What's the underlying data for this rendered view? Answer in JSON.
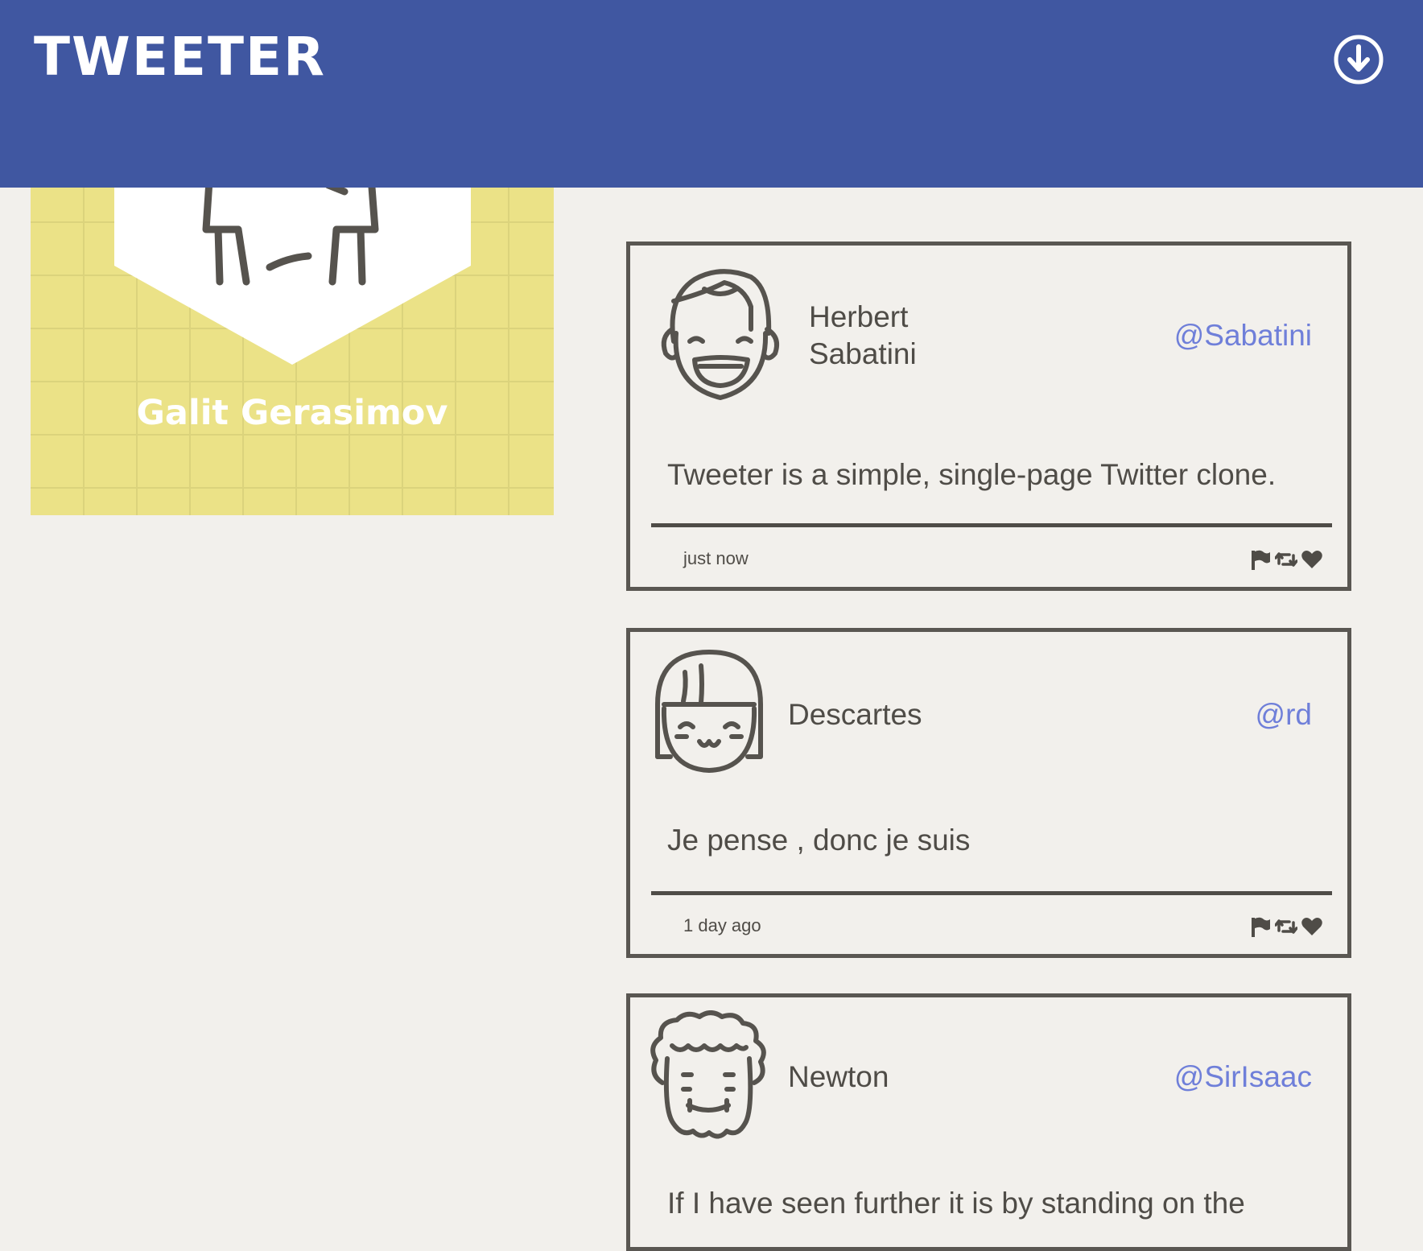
{
  "app": {
    "brand": "TWEETER",
    "header_icon": "download-circle-icon"
  },
  "colors": {
    "header": "#4057a1",
    "background": "#f2f0ec",
    "profile_bg": "#ebe287",
    "handle": "#6f7fd9",
    "border": "#5a5752"
  },
  "profile": {
    "name": "Galit Gerasimov"
  },
  "tweets": [
    {
      "name_line1": "Herbert",
      "name_line2": "Sabatini",
      "handle": "@Sabatini",
      "text": "Tweeter is a simple, single-page Twitter clone.",
      "time": "just now",
      "avatar": "smiling-man-avatar-icon"
    },
    {
      "name": "Descartes",
      "handle": "@rd",
      "text": "Je pense , donc je suis",
      "time": "1 day ago",
      "avatar": "girl-avatar-icon"
    },
    {
      "name": "Newton",
      "handle": "@SirIsaac",
      "text": "If I have seen further it is by standing on the",
      "avatar": "curly-haired-man-avatar-icon"
    }
  ],
  "actions": [
    "flag-icon",
    "retweet-icon",
    "heart-icon"
  ]
}
